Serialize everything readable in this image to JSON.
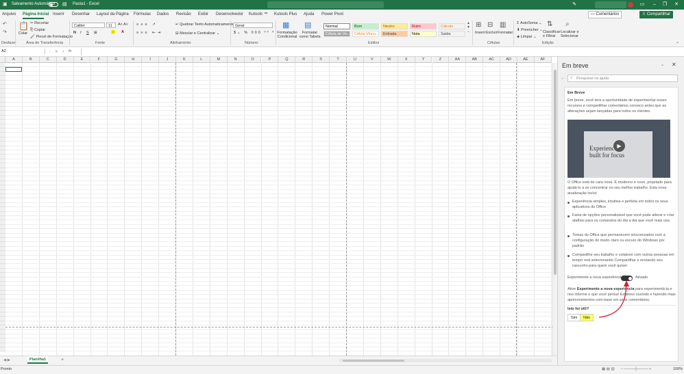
{
  "title_bar": {
    "autosave_label": "Salvamento Automático",
    "document_title": "Pasta1 - Excel"
  },
  "menu": {
    "tabs": [
      "Arquivo",
      "Página Inicial",
      "Inserir",
      "Desenhar",
      "Layout da Página",
      "Fórmulas",
      "Dados",
      "Revisão",
      "Exibir",
      "Desenvolvedor",
      "Kutools ™",
      "Kutools Plus",
      "Ajuda",
      "Power Pivot"
    ],
    "comments_label": "Comentários",
    "share_label": "Compartilhar"
  },
  "ribbon": {
    "clipboard": {
      "paste": "Colar",
      "cut": "Recortar",
      "copy": "Copiar",
      "format_painter": "Pincel de Formatação",
      "group": "Área de Transferência"
    },
    "undo_group": "Desfazer",
    "font": {
      "name": "Calibri",
      "size": "11",
      "group": "Fonte",
      "bold": "N",
      "italic": "I",
      "underline": "S"
    },
    "alignment": {
      "wrap": "Quebrar Texto Automaticamente",
      "merge": "Mesclar e Centralizar",
      "group": "Alinhamento"
    },
    "number": {
      "format": "Geral",
      "group": "Número"
    },
    "styles": {
      "conditional": "Formatação Condicional",
      "table": "Formatar como Tabela",
      "cells": [
        {
          "label": "Normal",
          "bg": "#ffffff",
          "fg": "#000000"
        },
        {
          "label": "Bom",
          "bg": "#c6efce",
          "fg": "#006100"
        },
        {
          "label": "Neutro",
          "bg": "#ffeb9c",
          "fg": "#9c5700"
        },
        {
          "label": "Ruim",
          "bg": "#ffc7ce",
          "fg": "#9c0006"
        },
        {
          "label": "Cálculo",
          "bg": "#f2f2f2",
          "fg": "#fa7d00"
        },
        {
          "label": "Célula de Ve...",
          "bg": "#a5a5a5",
          "fg": "#ffffff"
        },
        {
          "label": "Célula Vincu...",
          "bg": "#ffffff",
          "fg": "#fa7d00"
        },
        {
          "label": "Entrada",
          "bg": "#ffcc99",
          "fg": "#3f3f76"
        },
        {
          "label": "Nota",
          "bg": "#ffffcc",
          "fg": "#000000"
        },
        {
          "label": "Saída",
          "bg": "#f2f2f2",
          "fg": "#3f3f3f"
        }
      ],
      "group": "Estilos"
    },
    "cells": {
      "insert": "Inserir",
      "delete": "Excluir",
      "format": "Formatar",
      "group": "Células"
    },
    "editing": {
      "autosum": "AutoSoma",
      "fill": "Preencher",
      "clear": "Limpar",
      "sort": "Classificar e Filtrar",
      "find": "Localizar e Selecionar",
      "group": "Edição"
    }
  },
  "formula_bar": {
    "name_box": "A2",
    "fx": "fx"
  },
  "grid": {
    "columns": [
      "A",
      "B",
      "C",
      "D",
      "E",
      "F",
      "G",
      "H",
      "I",
      "J",
      "K",
      "L",
      "M",
      "N",
      "O",
      "P",
      "Q",
      "R",
      "S",
      "T",
      "U",
      "V",
      "W",
      "X",
      "Y",
      "Z",
      "AA",
      "AB",
      "AC",
      "AD",
      "AE",
      "AF"
    ]
  },
  "sheet": {
    "tab": "Planilha1",
    "add": "+"
  },
  "status": {
    "ready": "Pronto",
    "zoom": "100%"
  },
  "pane": {
    "title": "Em breve",
    "search_placeholder": "Pesquisar na ajuda",
    "card_title": "Em Breve",
    "intro": "Em breve, você terá a oportunidade de experimentar esses recursos e compartilhar comentários conosco antes que as alterações sejam lançadas para todos os clientes.",
    "video_text_1": "Experience",
    "video_text_2": "built for focus",
    "description": "O Office está de cara nova. É moderno e novo, projetado para ajudá-lo a se concentrar no seu melhor trabalho. Esta nova atualização inclui:",
    "bullets": [
      "Experiência simples, intuitiva e perfeita em todos os seus aplicativos do Office",
      "Faixa de opções personalizável que você pode alterar e criar atalhos para os comandos do dia a dia que você mais usa",
      "Temas do Office que permanecem sincronizados com a configuração do modo claro ou escuro do Windows por padrão",
      "Compartilhe seu trabalho e colabore com outras pessoas em tempo real selecionando Compartilhar e enviando seu rascunho para quem você quiser."
    ],
    "toggle_label": "Experimente a nova experiência",
    "toggle_state": "Ativado",
    "activate_pre": "Ative ",
    "activate_bold": "Experimente a nova experiência",
    "activate_post": " para experimentá-la e nos informe o que você pensa! Estamos ouvindo e fazendo mais aprimoramentos com base em seus comentários.",
    "feedback_q": "Isto foi útil?",
    "yes": "Sim",
    "no": "Não",
    "highlight_color": "#ffff66",
    "arrow_color": "#d0202a"
  }
}
